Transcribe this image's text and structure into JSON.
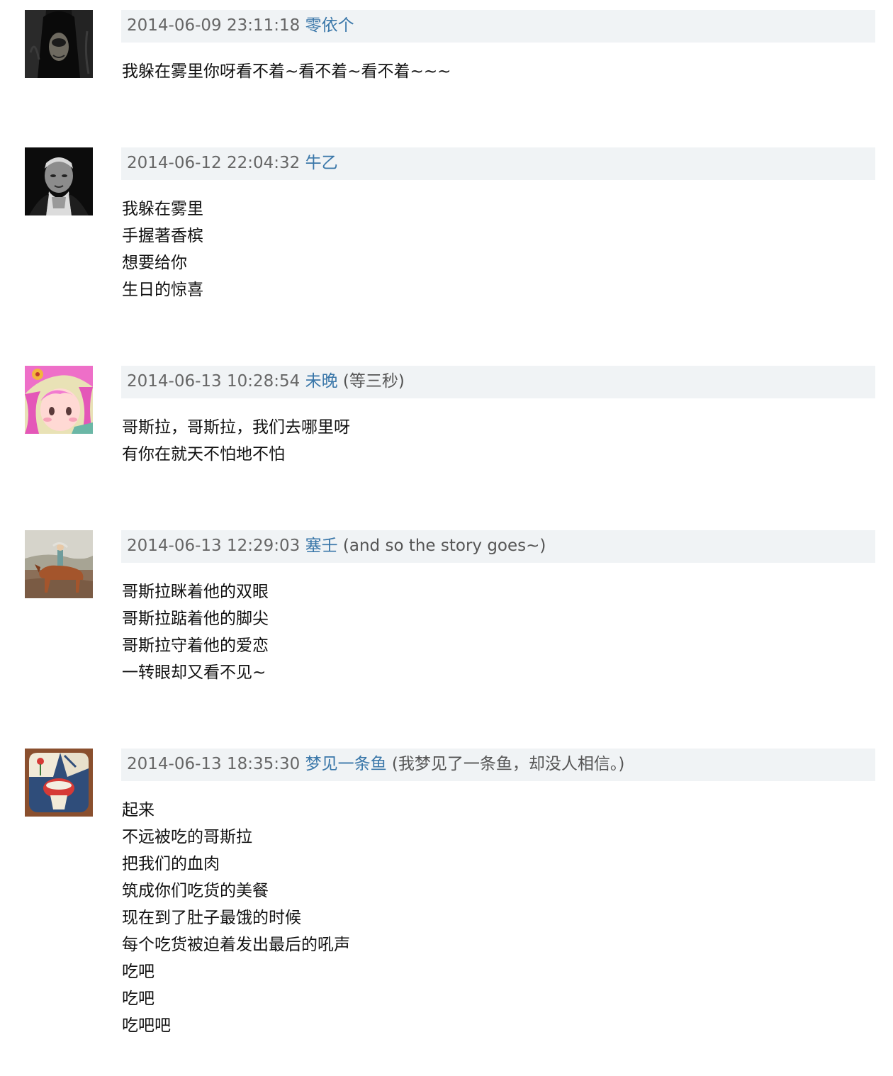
{
  "comments": [
    {
      "time": "2014-06-09 23:11:18",
      "user": "零依个",
      "signature": "",
      "avatar": "dark-hooded-figure",
      "lines": [
        "我躲在雾里你呀看不着~看不着~看不着~~~"
      ]
    },
    {
      "time": "2014-06-12 22:04:32",
      "user": "牛乙",
      "signature": "",
      "avatar": "black-and-white-portrait",
      "lines": [
        "我躲在雾里",
        "手握著香槟",
        "想要给你",
        "生日的惊喜"
      ]
    },
    {
      "time": "2014-06-13 10:28:54",
      "user": "未晚",
      "signature": "(等三秒)",
      "avatar": "pink-anime-girl",
      "lines": [
        "哥斯拉，哥斯拉，我们去哪里呀",
        "有你在就天不怕地不怕"
      ]
    },
    {
      "time": "2014-06-13 12:29:03",
      "user": "塞壬",
      "signature": "(and so the story goes~)",
      "avatar": "rider-on-horse",
      "lines": [
        "哥斯拉眯着他的双眼",
        "哥斯拉踮着他的脚尖",
        "哥斯拉守着他的爱恋",
        "一转眼却又看不见~"
      ]
    },
    {
      "time": "2014-06-13 18:35:30",
      "user": "梦见一条鱼",
      "signature": "(我梦见了一条鱼，却没人相信。)",
      "avatar": "painted-illustration",
      "lines": [
        "起来",
        "不远被吃的哥斯拉",
        "把我们的血肉",
        "筑成你们吃货的美餐",
        "现在到了肚子最饿的时候",
        "每个吃货被迫着发出最后的吼声",
        "吃吧",
        "吃吧",
        "吃吧吧"
      ]
    }
  ]
}
